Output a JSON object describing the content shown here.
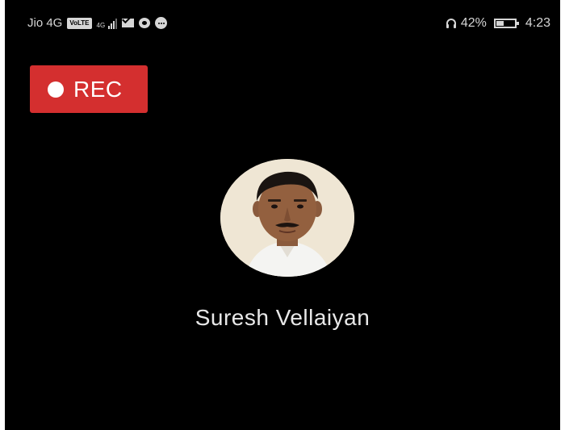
{
  "status_bar": {
    "carrier": "Jio 4G",
    "volte": "VoLTE",
    "network_type": "4G",
    "battery_percent": "42%",
    "battery_level": 0.42,
    "time": "4:23",
    "icons": [
      "volte-icon",
      "signal-icon",
      "mail-icon",
      "chat-bubble-icon",
      "more-icon",
      "headset-icon",
      "battery-icon"
    ]
  },
  "record_button": {
    "label": "REC"
  },
  "contact": {
    "name": "Suresh Vellaiyan"
  },
  "colors": {
    "background": "#000000",
    "rec_button": "#d42f2f",
    "text": "#e8e8e8"
  }
}
